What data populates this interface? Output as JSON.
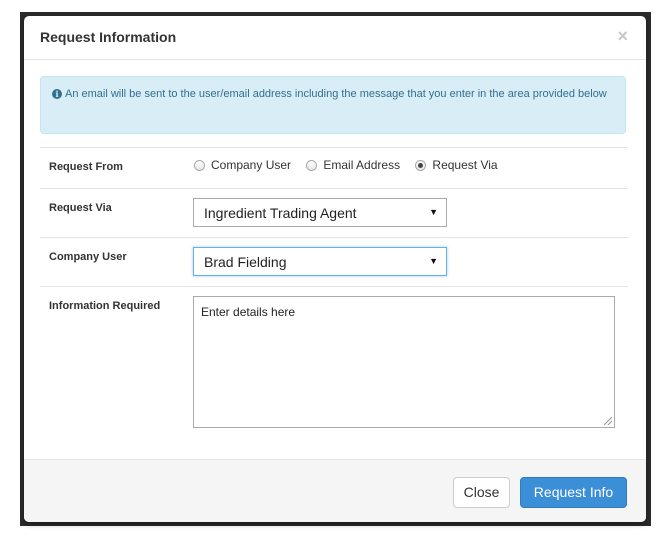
{
  "dialog": {
    "title": "Request Information",
    "close_glyph": "×",
    "info_icon": "info-circle-icon",
    "info_message": "An email will be sent to the user/email address including the message that you enter in the area provided below"
  },
  "form": {
    "request_from": {
      "label": "Request From",
      "options": [
        "Company User",
        "Email Address",
        "Request Via"
      ],
      "selected": "Request Via"
    },
    "request_via": {
      "label": "Request Via",
      "value": "Ingredient Trading Agent"
    },
    "company_user": {
      "label": "Company User",
      "value": "Brad Fielding"
    },
    "information_required": {
      "label": "Information Required",
      "placeholder": "Enter details here"
    }
  },
  "footer": {
    "close_label": "Close",
    "request_label": "Request Info"
  },
  "colors": {
    "primary": "#3b8fd6",
    "info_bg": "#d9edf7",
    "info_text": "#31708f"
  }
}
